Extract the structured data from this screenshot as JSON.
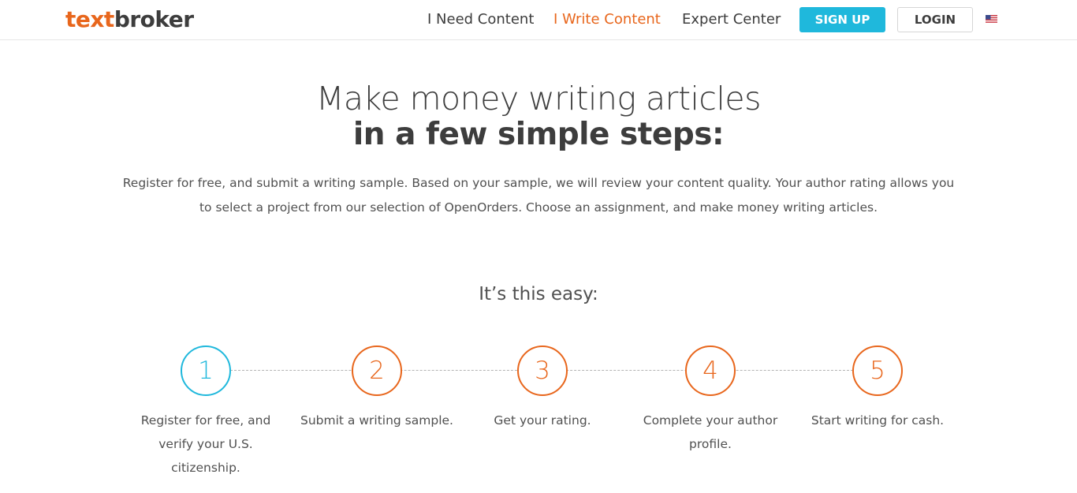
{
  "header": {
    "logo_text": "text",
    "logo_broker": "broker",
    "nav": [
      {
        "label": "I Need Content"
      },
      {
        "label": "I Write Content"
      },
      {
        "label": "Expert Center"
      }
    ],
    "signup_label": "SIGN UP",
    "login_label": "LOGIN",
    "language_icon": "us-flag-icon"
  },
  "hero": {
    "title_line1": "Make money writing articles",
    "title_line2": "in a few simple steps:",
    "description": "Register for free, and submit a writing sample. Based on your sample, we will review your content quality. Your author rating allows you to select a project from our selection of OpenOrders. Choose an assignment, and make money writing articles."
  },
  "steps": {
    "title": "It’s this easy:",
    "items": [
      {
        "number": "1",
        "label": "Register for free, and verify your U.S. citizenship."
      },
      {
        "number": "2",
        "label": "Submit a writing sample."
      },
      {
        "number": "3",
        "label": "Get your rating."
      },
      {
        "number": "4",
        "label": "Complete your author profile."
      },
      {
        "number": "5",
        "label": "Start writing for cash."
      }
    ]
  },
  "colors": {
    "brand_orange": "#e8661c",
    "accent_blue": "#1fb8dc",
    "text_dark": "#3d3d3d"
  }
}
